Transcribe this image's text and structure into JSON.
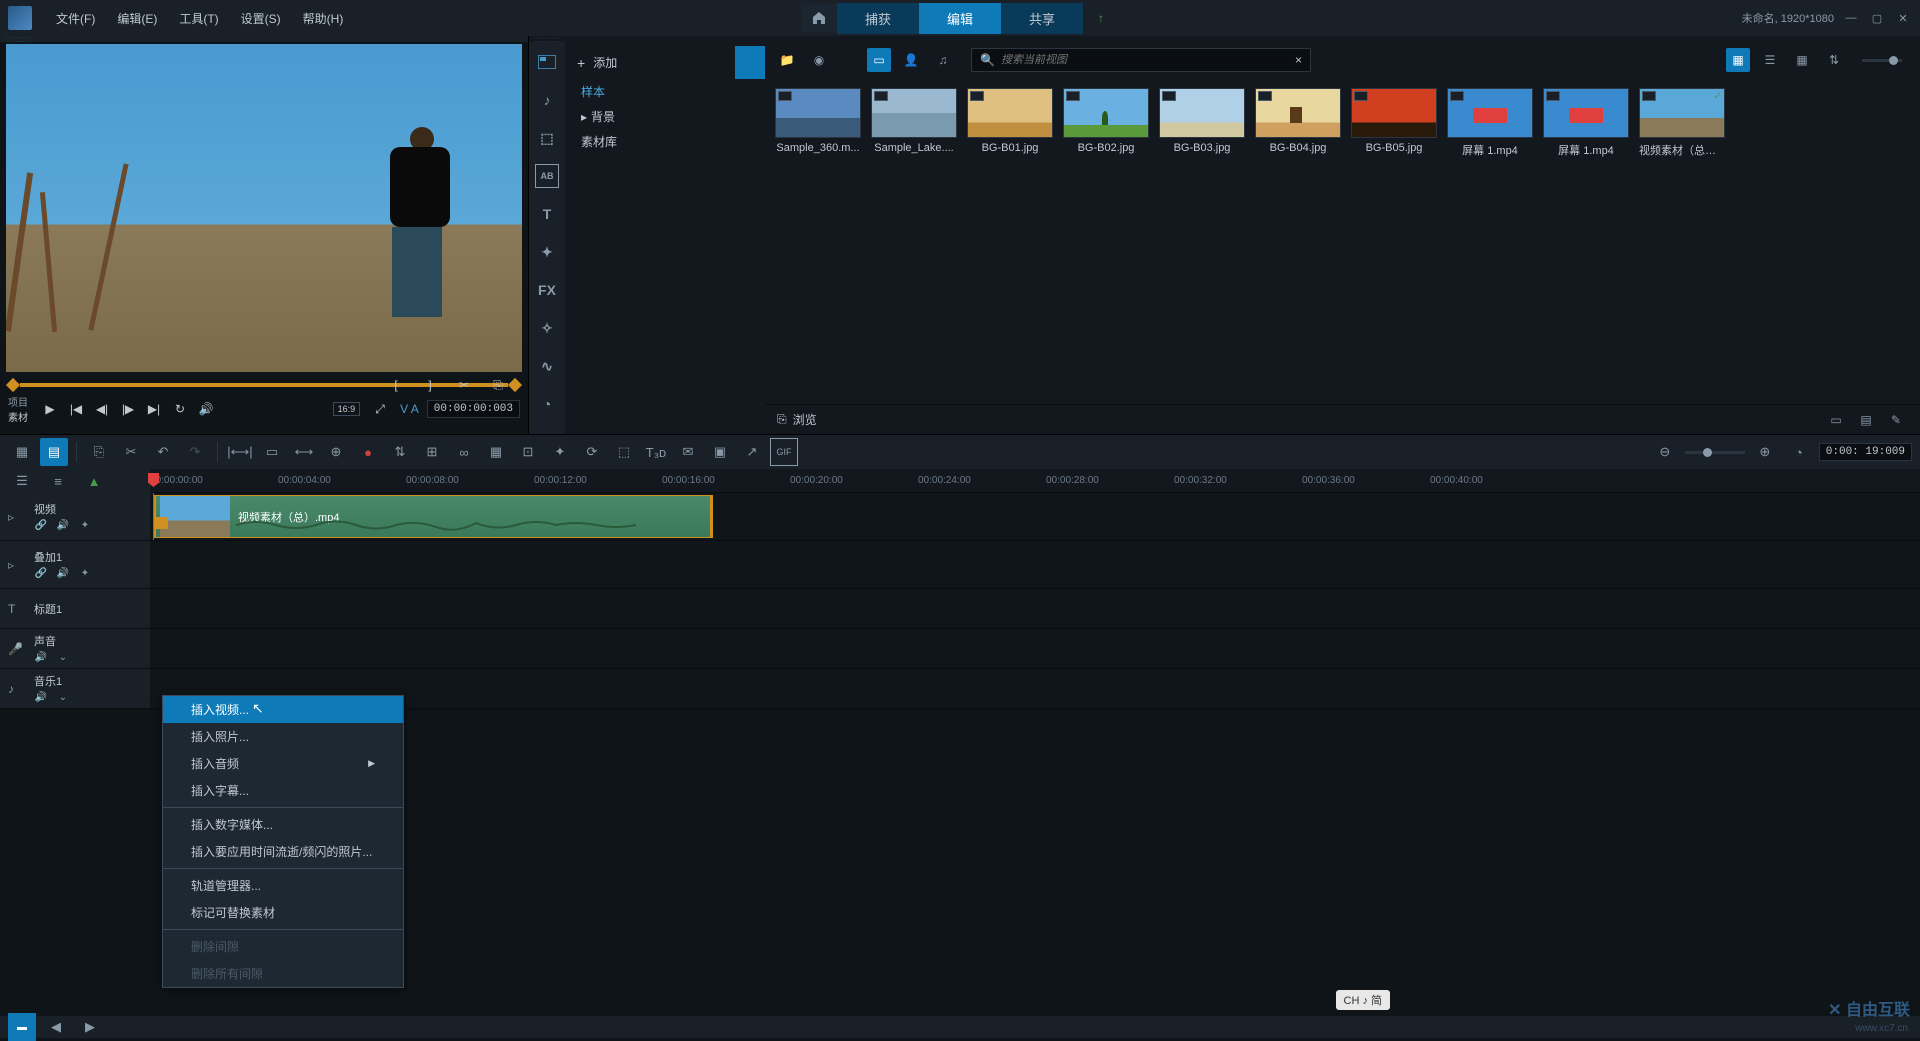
{
  "menubar": {
    "file": "文件(F)",
    "edit": "编辑(E)",
    "tools": "工具(T)",
    "settings": "设置(S)",
    "help": "帮助(H)"
  },
  "tabs": {
    "capture": "捕获",
    "edit": "编辑",
    "share": "共享"
  },
  "project_info": "未命名, 1920*1080",
  "preview": {
    "label1": "项目",
    "label2": "素材",
    "timecode": "00:00:00:003",
    "aspect": "16:9",
    "va": "V A"
  },
  "library": {
    "add": "添加",
    "tree": {
      "sample": "样本",
      "background": "背景",
      "library": "素材库"
    },
    "search_placeholder": "搜索当前视图",
    "browse": "浏览",
    "items": [
      {
        "label": "Sample_360.m...",
        "thumb": "thumb-sample360"
      },
      {
        "label": "Sample_Lake....",
        "thumb": "thumb-lake"
      },
      {
        "label": "BG-B01.jpg",
        "thumb": "thumb-b01"
      },
      {
        "label": "BG-B02.jpg",
        "thumb": "thumb-b02"
      },
      {
        "label": "BG-B03.jpg",
        "thumb": "thumb-b03"
      },
      {
        "label": "BG-B04.jpg",
        "thumb": "thumb-b04"
      },
      {
        "label": "BG-B05.jpg",
        "thumb": "thumb-b05"
      },
      {
        "label": "屏幕 1.mp4",
        "thumb": "thumb-screen"
      },
      {
        "label": "屏幕 1.mp4",
        "thumb": "thumb-screen"
      },
      {
        "label": "视频素材（总）....",
        "thumb": "thumb-video",
        "checked": true
      }
    ]
  },
  "timeline": {
    "timecode": "0:00: 19:009",
    "ruler": [
      "00:00:00:00",
      "00:00:04:00",
      "00:00:08:00",
      "00:00:12:00",
      "00:00:16:00",
      "00:00:20:00",
      "00:00:24:00",
      "00:00:28:00",
      "00:00:32:00",
      "00:00:36:00",
      "00:00:40:00"
    ],
    "tracks": {
      "video": "视频",
      "overlay1": "叠加1",
      "title1": "标题1",
      "sound": "声音",
      "music1": "音乐1"
    },
    "clip_label": "视频素材（总）.mp4"
  },
  "context_menu": {
    "insert_video": "插入视频...",
    "insert_photo": "插入照片...",
    "insert_audio": "插入音频",
    "insert_subtitle": "插入字幕...",
    "insert_digital": "插入数字媒体...",
    "insert_timelapse": "插入要应用时间流逝/频闪的照片...",
    "track_manager": "轨道管理器...",
    "mark_replaceable": "标记可替换素材",
    "delete_gap": "删除间隙",
    "delete_all_gaps": "删除所有间隙"
  },
  "ime": "CH ♪ 简",
  "watermark": "自由互联",
  "watermark_url": "www.xc7.cn"
}
